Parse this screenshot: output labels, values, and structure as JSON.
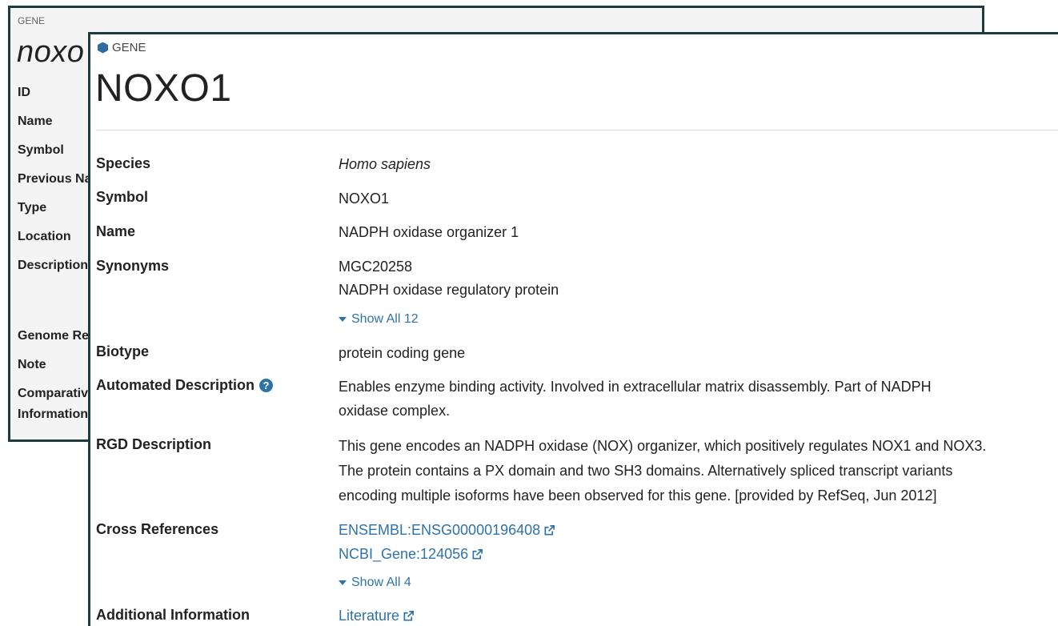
{
  "back_window": {
    "eyebrow": "GENE",
    "title": "noxo",
    "labels": [
      "ID",
      "Name",
      "Symbol",
      "Previous Na",
      "Type",
      "Location",
      "Description",
      "Genome Re",
      "Note",
      "Comparativ",
      "Information"
    ]
  },
  "front_window": {
    "eyebrow": "GENE",
    "title": "NOXO1",
    "rows": {
      "species": {
        "label": "Species",
        "value": "Homo sapiens"
      },
      "symbol": {
        "label": "Symbol",
        "value": "NOXO1"
      },
      "name": {
        "label": "Name",
        "value": "NADPH oxidase organizer 1"
      },
      "synonyms": {
        "label": "Synonyms",
        "values": [
          "MGC20258",
          "NADPH oxidase regulatory protein"
        ],
        "show_all": "Show All 12"
      },
      "biotype": {
        "label": "Biotype",
        "value": "protein coding gene"
      },
      "automated_description": {
        "label": "Automated Description",
        "lines": [
          "Enables enzyme binding activity. Involved in extracellular matrix disassembly. Part of NADPH",
          "oxidase complex."
        ]
      },
      "rgd_description": {
        "label": "RGD Description",
        "lines": [
          "This gene encodes an NADPH oxidase (NOX) organizer, which positively regulates NOX1 and NOX3.",
          "The protein contains a PX domain and two SH3 domains. Alternatively spliced transcript variants",
          "encoding multiple isoforms have been observed for this gene. [provided by RefSeq, Jun 2012]"
        ]
      },
      "cross_references": {
        "label": "Cross References",
        "links": [
          "ENSEMBL:ENSG00000196408",
          "NCBI_Gene:124056"
        ],
        "show_all": "Show All 4"
      },
      "additional_information": {
        "label": "Additional Information",
        "link": "Literature"
      }
    }
  },
  "colors": {
    "link": "#2e73a8",
    "border": "#1d3d3d",
    "gene_icon": "#2f6c9f"
  },
  "icons": {
    "gene": "hexagon-icon",
    "help": "question-circle-icon",
    "external": "external-link-icon",
    "expand": "caret-down-icon"
  }
}
